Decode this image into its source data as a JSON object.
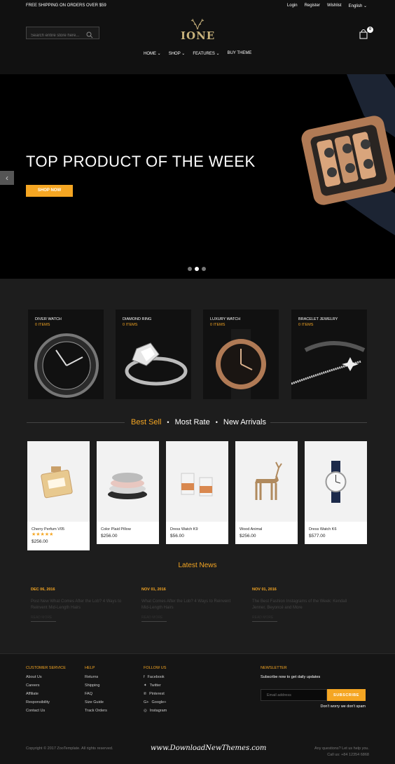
{
  "topbar": {
    "shipping": "FREE SHIPPING ON ORDERS OVER $59",
    "login": "Login",
    "register": "Register",
    "wishlist": "Wishlist",
    "language": "English"
  },
  "header": {
    "search_placeholder": "Search entire store here...",
    "logo": "IONE",
    "cart_count": "0",
    "nav": [
      "HOME",
      "SHOP",
      "FEATURES",
      "BUY THEME"
    ]
  },
  "hero": {
    "title": "TOP PRODUCT OF THE WEEK",
    "button": "SHOP NOW",
    "slides": 3,
    "active_slide": 2
  },
  "categories": [
    {
      "name": "DIVER WATCH",
      "count": "0 ITEMS"
    },
    {
      "name": "DIAMOND RING",
      "count": "0 ITEMS"
    },
    {
      "name": "LUXURY WATCH",
      "count": "0 ITEMS"
    },
    {
      "name": "BRACELET JEWELRY",
      "count": "0 ITEMS"
    }
  ],
  "tabs": [
    "Best Sell",
    "Most Rate",
    "New Arrivals"
  ],
  "products": [
    {
      "name": "Cherry Perfum V05",
      "price": "$256.00",
      "stars": "★★★★★"
    },
    {
      "name": "Color Plaid Pillow",
      "price": "$256.00"
    },
    {
      "name": "Dress Watch K9",
      "price": "$56.00"
    },
    {
      "name": "Wood Animal",
      "price": "$256.00"
    },
    {
      "name": "Dress Watch K6",
      "price": "$577.00"
    }
  ],
  "news": {
    "title": "Latest News",
    "items": [
      {
        "date": "DEC 06, 2016",
        "title": "Post New What Comes After the Lob? 4 Ways to Reinvent Mid-Length Hairs",
        "more": "READ MORE"
      },
      {
        "date": "NOV 01, 2016",
        "title": "What Comes After the Lob? 4 Ways to Reinvent Mid-Length Hairs",
        "more": "READ MORE"
      },
      {
        "date": "NOV 01, 2016",
        "title": "The Best Fashion Instagrams of the Week: Kendall Jenner, Beyoncé and More",
        "more": "READ MORE"
      }
    ]
  },
  "footer": {
    "customer_service": {
      "heading": "CUSTOMER SERVICE",
      "items": [
        "About Us",
        "Careers",
        "Affiliate",
        "Responsibility",
        "Contact Us"
      ]
    },
    "help": {
      "heading": "HELP",
      "items": [
        "Returns",
        "Shipping",
        "FAQ",
        "Size Guide",
        "Track Orders"
      ]
    },
    "follow": {
      "heading": "FOLLOW US",
      "items": [
        "Facebook",
        "Twitter",
        "Pinterest",
        "Google+",
        "Instagram"
      ]
    },
    "newsletter": {
      "heading": "NEWSLETTER",
      "subtitle": "Subscribe now to get daily updates",
      "placeholder": "Email address",
      "button": "SUBSCRIBE",
      "note": "Don't worry we don't spam"
    },
    "copyright": "Copyright © 2017 ZooTemplate. All rights reserved.",
    "watermark": "www.DownloadNewThemes.com",
    "contact_q": "Any questions? Let us help you.",
    "contact_phone": "Call us: +84 12354 6868"
  },
  "colors": {
    "accent": "#f5a623",
    "background": "#1d1d1d",
    "header": "#111111"
  }
}
